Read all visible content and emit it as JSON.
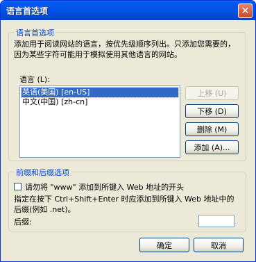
{
  "window": {
    "title": "语言首选项",
    "close_glyph": "✕"
  },
  "language_group": {
    "title": "语言首选项",
    "description": "添加用于阅读网站的语言，按优先级顺序列出。只添加您需要的，因为某些字符可能用于模拟使用其他语言的网站。",
    "list_label": "语言 (L):",
    "languages": [
      "英语(美国) [en-US]",
      "中文(中国) [zh-cn]"
    ],
    "buttons": {
      "move_up": "上移 (U)",
      "move_down": "下移 (D)",
      "remove": "删除 (M)",
      "add": "添加 (A)..."
    }
  },
  "prefix_group": {
    "title": "前缀和后缀选项",
    "checkbox_label": "请勿将 \"www\" 添加到所键入 Web 地址的开头",
    "description": "指定在按下 Ctrl+Shift+Enter 时应添加到所键入 Web 地址中的后缀(例如 .net)。",
    "suffix_label": "后缀:",
    "suffix_value": ""
  },
  "footer": {
    "ok": "确定",
    "cancel": "取消"
  }
}
